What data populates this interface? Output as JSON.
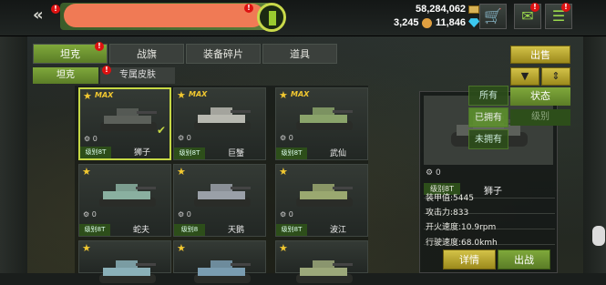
{
  "header": {
    "gold": "58,284,062",
    "coins": "3,245",
    "gems": "11,846",
    "badge_mark": "!"
  },
  "tabs": [
    {
      "label": "坦克"
    },
    {
      "label": "战旗"
    },
    {
      "label": "装备碎片"
    },
    {
      "label": "道具"
    }
  ],
  "subtabs": [
    {
      "label": "坦克"
    },
    {
      "label": "专属皮肤"
    }
  ],
  "cards": [
    {
      "max": "MAX",
      "count": "0",
      "tier": "级别8T",
      "name": "狮子",
      "color": "#5c605a"
    },
    {
      "max": "MAX",
      "count": "0",
      "tier": "级别8T",
      "name": "巨蟹",
      "color": "#b8b8b0"
    },
    {
      "max": "MAX",
      "count": "0",
      "tier": "级别8T",
      "name": "武仙",
      "color": "#8aa36a"
    },
    {
      "max": "",
      "count": "0",
      "tier": "级别8T",
      "name": "蛇夫",
      "color": "#8ab0a0"
    },
    {
      "max": "",
      "count": "0",
      "tier": "级别8",
      "name": "天鹅",
      "color": "#9aa0a8"
    },
    {
      "max": "",
      "count": "0",
      "tier": "级别8T",
      "name": "波江",
      "color": "#9aa870"
    },
    {
      "max": "",
      "count": "",
      "tier": "",
      "name": "",
      "color": "#8ab0b8"
    },
    {
      "max": "",
      "count": "",
      "tier": "",
      "name": "",
      "color": "#7a9cb0"
    },
    {
      "max": "",
      "count": "",
      "tier": "",
      "name": "",
      "color": "#9ca87a"
    }
  ],
  "detail": {
    "count": "0",
    "tier": "级别8T",
    "name": "狮子",
    "armor": "装甲值:5445",
    "attack": "攻击力:833",
    "fire_rate": "开火速度:10.9rpm",
    "speed": "行驶速度:68.0kmh"
  },
  "controls": {
    "sell": "出售",
    "filter_icon": "filter-icon",
    "sort_icon": "sort-icon",
    "status": "状态",
    "tier_option": "级别",
    "dropdown": [
      "所有",
      "已拥有",
      "未拥有"
    ],
    "details": "详情",
    "deploy": "出战"
  }
}
